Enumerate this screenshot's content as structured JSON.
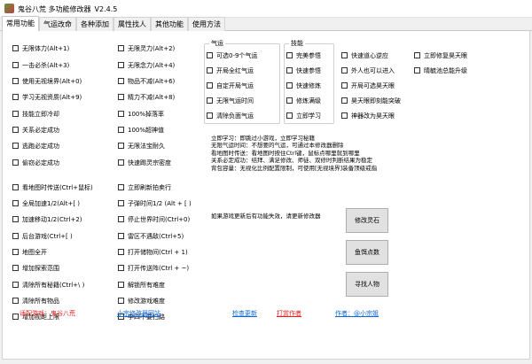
{
  "window": {
    "title": "鬼谷八荒 多功能修改器",
    "version": "V2.4.5"
  },
  "colors": {
    "accent_red": "#e21b1b",
    "link_blue": "#0b66d6"
  },
  "tabs": [
    "常用功能",
    "气运改命",
    "各种添加",
    "属性找人",
    "其他功能",
    "使用方法"
  ],
  "col1": [
    "无限体力(Alt+1)",
    "一击必杀(Alt+3)",
    "使用无视境界(Alt+0)",
    "学习无视资质(Alt+9)",
    "技能立即冷却",
    "关系必定成功",
    "逃跑必定成功",
    "偷窃必定成功",
    "看地图时传送(Ctrl+鼠标)",
    "全局加速1/2(Alt+[ )",
    "加速移动1/2(Ctrl+2)",
    "后台游戏(Ctrl+[ )",
    "地图全开",
    "增加探索范围",
    "清除所有秘籍(Ctrl+\\ )",
    "清除所有物品",
    "增加视距上限"
  ],
  "col2": [
    "无限灵力(Alt+2)",
    "无限念力(Alt+4)",
    "物品不减(Alt+6)",
    "精力不减(Alt+8)",
    "100%掉落率",
    "100%超神值",
    "无限法宝耐久",
    "快速踢灵宗密度",
    "立即刷新拍卖行",
    "子弹时间1/2 (Alt + [ )",
    "停止世界时间(Ctrl+0)",
    "雷区不遇敌(Ctrl+5)",
    "打开储物间(Ctrl + 1)",
    "打开传送阵(Ctrl + ~)",
    "解锁所有难度",
    "修改游戏难度",
    "李四不要扫路"
  ],
  "qiyun": {
    "title": "气运",
    "items": [
      "可选0-9个气运",
      "开局全红气运",
      "自定开局气运",
      "无限气运时间",
      "清除负面气运"
    ]
  },
  "jineng": {
    "title": "技能",
    "items": [
      "完美参悟",
      "快速参悟",
      "快速修炼",
      "修炼满级",
      "立即学习"
    ]
  },
  "col5": [
    "快速道心逆应",
    "外人也可以进入",
    "开局可选昊天眼",
    "昊天眼即刻能突破",
    "神器改为昊天眼"
  ],
  "col6": [
    "立即修复昊天眼",
    "晴毓池总能升级"
  ],
  "info": [
    "立即学习：即跳过小游戏，立即学习秘籍",
    "无限气运时间：不想要的气运，可通过本修改器删除",
    "看地图时传送：看地图时按住Ctrl键，鼠标点哪里就到哪里",
    "关系必定成功：结拜、满足修改、师徒、双修时判断结果为稳定",
    "背包容量：无视化比例配置限制，可使用[无视境界]装备顶级戒指"
  ],
  "note": "如果游戏更新后有功能失效，请更新修改器",
  "buttons": {
    "stone": "修改灵石",
    "fish": "鱼饵点数",
    "find": "寻找人物"
  },
  "footer": {
    "game_label": "适配游戏：",
    "game_name": "鬼谷八荒",
    "site": "小宗修改器网站",
    "update": "检查更新",
    "donate": "打赏作者",
    "author_label": "作者：",
    "author": "@小宗姐"
  }
}
